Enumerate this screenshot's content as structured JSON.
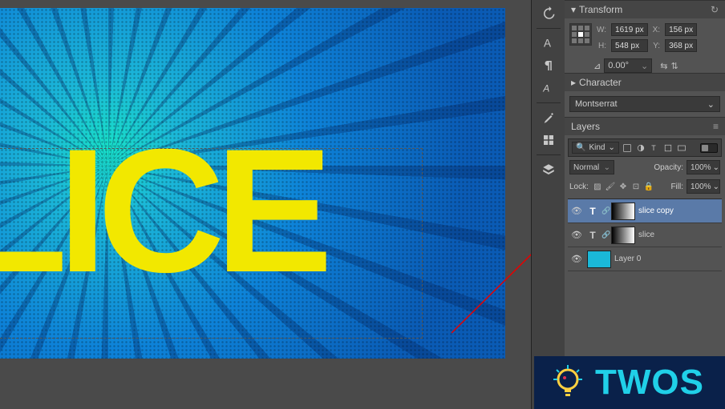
{
  "transform": {
    "title": "Transform",
    "w_label": "W:",
    "w_value": "1619 px",
    "h_label": "H:",
    "h_value": "548 px",
    "x_label": "X:",
    "x_value": "156 px",
    "y_label": "Y:",
    "y_value": "368 px",
    "angle_label": "⊿",
    "angle_value": "0.00°"
  },
  "character": {
    "title": "Character",
    "font_family": "Montserrat"
  },
  "layers": {
    "title": "Layers",
    "kind_label": "Kind",
    "blend_mode": "Normal",
    "opacity_label": "Opacity:",
    "opacity_value": "100%",
    "lock_label": "Lock:",
    "fill_label": "Fill:",
    "fill_value": "100%",
    "items": [
      {
        "name": "slice copy"
      },
      {
        "name": "slice"
      },
      {
        "name": "Layer 0"
      }
    ]
  },
  "canvas_text": "LICE",
  "watermark": "TWOS"
}
